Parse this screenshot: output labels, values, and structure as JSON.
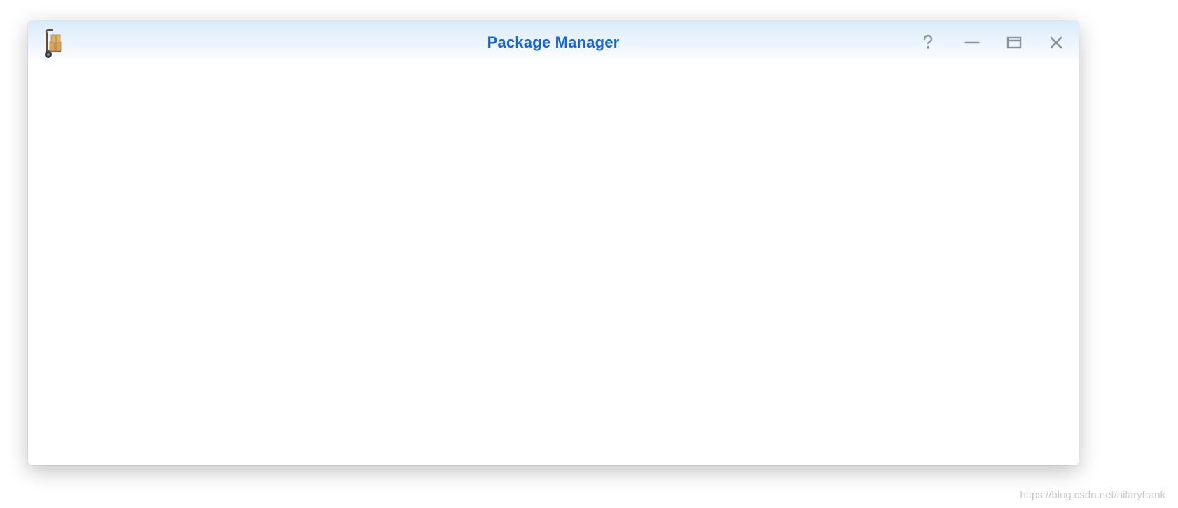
{
  "window": {
    "title": "Package Manager"
  },
  "watermark": "https://blog.csdn.net/hilaryfrank"
}
